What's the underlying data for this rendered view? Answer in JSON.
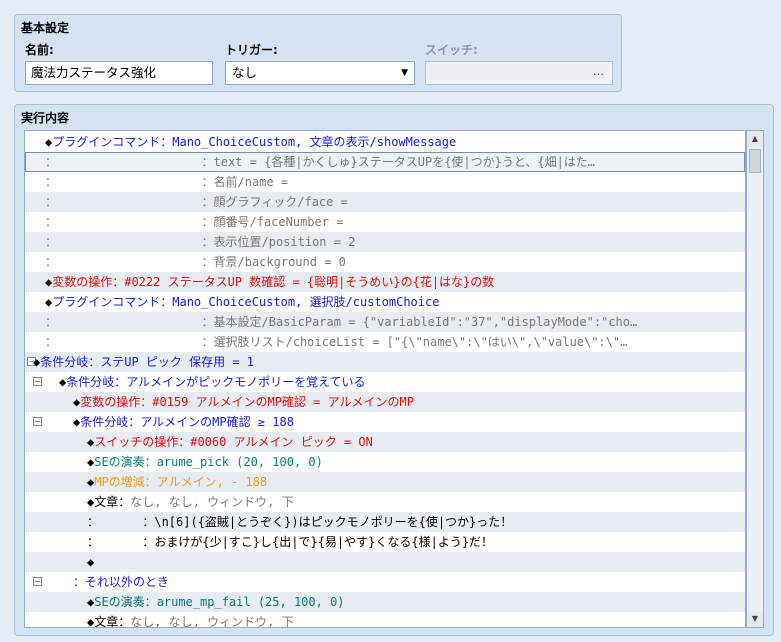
{
  "basic_settings": {
    "title": "基本設定",
    "name_label": "名前:",
    "name_value": "魔法力ステータス強化",
    "trigger_label": "トリガー:",
    "trigger_value": "なし",
    "switch_label": "スイッチ:",
    "switch_button": "…"
  },
  "contents": {
    "title": "実行内容",
    "rows": [
      {
        "indent": 20,
        "parts": [
          {
            "t": "◆",
            "c": "black"
          },
          {
            "t": "プラグインコマンド：",
            "c": "blue"
          },
          {
            "t": "Mano_ChoiceCustom, 文章の表示/showMessage",
            "c": "blue"
          }
        ]
      },
      {
        "indent": 20,
        "selected": true,
        "parts": [
          {
            "t": "：                    ：",
            "c": "gray"
          },
          {
            "t": "text = {各種|かくしゅ}ステータスUPを{使|つか}うと、{畑|はた…",
            "c": "gray"
          }
        ]
      },
      {
        "indent": 20,
        "parts": [
          {
            "t": "：                    ：",
            "c": "gray"
          },
          {
            "t": "名前/name =",
            "c": "gray"
          }
        ]
      },
      {
        "indent": 20,
        "parts": [
          {
            "t": "：                    ：",
            "c": "gray"
          },
          {
            "t": "顔グラフィック/face =",
            "c": "gray"
          }
        ]
      },
      {
        "indent": 20,
        "parts": [
          {
            "t": "：                    ：",
            "c": "gray"
          },
          {
            "t": "顔番号/faceNumber =",
            "c": "gray"
          }
        ]
      },
      {
        "indent": 20,
        "parts": [
          {
            "t": "：                    ：",
            "c": "gray"
          },
          {
            "t": "表示位置/position = 2",
            "c": "gray"
          }
        ]
      },
      {
        "indent": 20,
        "parts": [
          {
            "t": "：                    ：",
            "c": "gray"
          },
          {
            "t": "背景/background = 0",
            "c": "gray"
          }
        ]
      },
      {
        "indent": 20,
        "parts": [
          {
            "t": "◆",
            "c": "black"
          },
          {
            "t": "変数の操作：#0222 ステータスUP 数確認 = {聡明|そうめい}の{花|はな}の数",
            "c": "red"
          }
        ]
      },
      {
        "indent": 20,
        "parts": [
          {
            "t": "◆",
            "c": "black"
          },
          {
            "t": "プラグインコマンド：",
            "c": "blue"
          },
          {
            "t": "Mano_ChoiceCustom, 選択肢/customChoice",
            "c": "blue"
          }
        ]
      },
      {
        "indent": 20,
        "parts": [
          {
            "t": "：                    ：",
            "c": "gray"
          },
          {
            "t": "基本設定/BasicParam = {\"variableId\":\"37\",\"displayMode\":\"cho…",
            "c": "gray"
          }
        ]
      },
      {
        "indent": 20,
        "parts": [
          {
            "t": "：                    ：",
            "c": "gray"
          },
          {
            "t": "選択肢リスト/choiceList = [\"{\\\"name\\\":\\\"はい\\\",\\\"value\\\":\\\"…",
            "c": "gray"
          }
        ]
      },
      {
        "indent": 8,
        "collapse": 2,
        "parts": [
          {
            "t": "◆",
            "c": "black"
          },
          {
            "t": "条件分岐：ステUP ピック 保存用 = 1",
            "c": "blue"
          }
        ]
      },
      {
        "indent": 34,
        "collapse": 8,
        "parts": [
          {
            "t": "◆",
            "c": "black"
          },
          {
            "t": "条件分岐：アルメインがピックモノポリーを覚えている",
            "c": "blue"
          }
        ]
      },
      {
        "indent": 48,
        "parts": [
          {
            "t": "◆",
            "c": "black"
          },
          {
            "t": "変数の操作：#0159 アルメインのMP確認 = アルメインのMP",
            "c": "red"
          }
        ]
      },
      {
        "indent": 48,
        "collapse": 8,
        "parts": [
          {
            "t": "◆",
            "c": "black"
          },
          {
            "t": "条件分岐：アルメインのMP確認 ≥ 188",
            "c": "blue"
          }
        ]
      },
      {
        "indent": 62,
        "parts": [
          {
            "t": "◆",
            "c": "black"
          },
          {
            "t": "スイッチの操作：#0060 アルメイン ピック = ON",
            "c": "red"
          }
        ]
      },
      {
        "indent": 62,
        "parts": [
          {
            "t": "◆",
            "c": "black"
          },
          {
            "t": "SEの演奏：",
            "c": "teal"
          },
          {
            "t": "arume_pick (20, 100, 0)",
            "c": "teal"
          }
        ]
      },
      {
        "indent": 62,
        "parts": [
          {
            "t": "◆",
            "c": "black"
          },
          {
            "t": "MPの増減：アルメイン, - 188",
            "c": "orange"
          }
        ]
      },
      {
        "indent": 62,
        "parts": [
          {
            "t": "◆",
            "c": "black"
          },
          {
            "t": "文章：",
            "c": "black"
          },
          {
            "t": "なし, なし, ウィンドウ, 下",
            "c": "gray"
          }
        ]
      },
      {
        "indent": 62,
        "parts": [
          {
            "t": "：      ：",
            "c": "black"
          },
          {
            "t": "\\n[6]({盗賊|とうぞく})はピックモノポリーを{使|つか}った！",
            "c": "black"
          }
        ]
      },
      {
        "indent": 62,
        "parts": [
          {
            "t": "：      ：",
            "c": "black"
          },
          {
            "t": "おまけが{少|すこ}し{出|で}{易|やす}くなる{様|よう}だ！",
            "c": "black"
          }
        ]
      },
      {
        "indent": 62,
        "parts": [
          {
            "t": "◆",
            "c": "black"
          }
        ]
      },
      {
        "indent": 48,
        "collapse": 8,
        "parts": [
          {
            "t": "：",
            "c": "blue"
          },
          {
            "t": "それ以外のとき",
            "c": "blue"
          }
        ]
      },
      {
        "indent": 62,
        "parts": [
          {
            "t": "◆",
            "c": "black"
          },
          {
            "t": "SEの演奏：",
            "c": "teal"
          },
          {
            "t": "arume_mp_fail (25, 100, 0)",
            "c": "teal"
          }
        ]
      },
      {
        "indent": 62,
        "parts": [
          {
            "t": "◆",
            "c": "black"
          },
          {
            "t": "文章：",
            "c": "black"
          },
          {
            "t": "なし, なし, ウィンドウ, 下",
            "c": "gray"
          }
        ]
      }
    ]
  },
  "colors": {
    "blue": "#1a1ad6",
    "red": "#e01010",
    "teal": "#0b7a7a",
    "orange": "#f09a1a",
    "gray": "#777777",
    "black": "#000000"
  }
}
